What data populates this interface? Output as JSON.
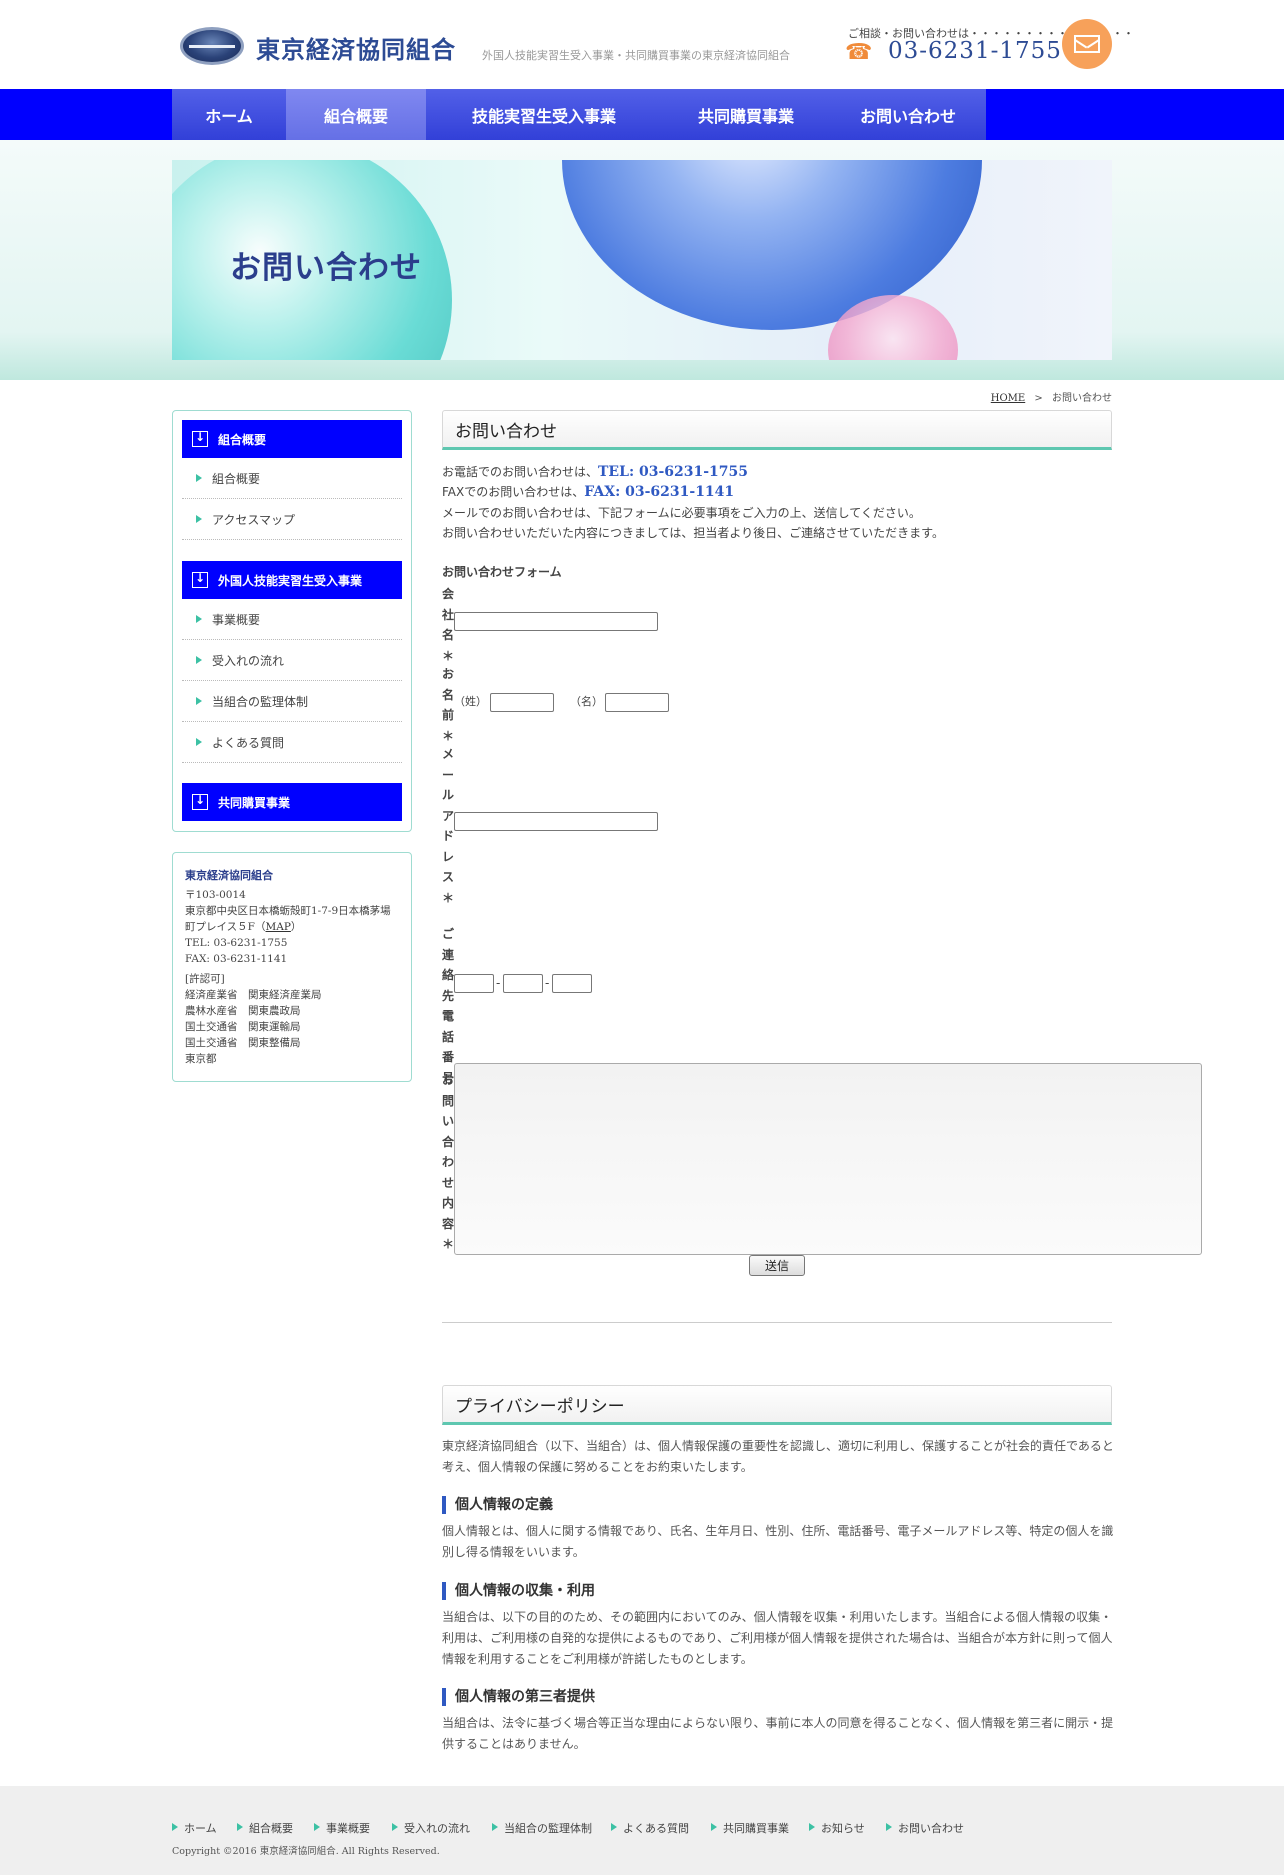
{
  "header": {
    "logo_text": "東京経済協同組合",
    "tagline": "外国人技能実習生受入事業・共同購買事業の東京経済協同組合",
    "contact_lead": "ご相談・お問い合わせは・・・・・・・・・・・・・・・",
    "phone": "03-6231-1755",
    "phone_icon": "☎"
  },
  "nav": {
    "items": [
      "ホーム",
      "組合概要",
      "技能実習生受入事業",
      "共同購買事業",
      "お問い合わせ"
    ]
  },
  "banner": {
    "title": "お問い合わせ"
  },
  "breadcrumb": {
    "home": "HOME",
    "sep": ">",
    "current": "お問い合わせ"
  },
  "sidebar": {
    "groups": [
      {
        "heading": "組合概要",
        "items": [
          "組合概要",
          "アクセスマップ"
        ]
      },
      {
        "heading": "外国人技能実習生受入事業",
        "items": [
          "事業概要",
          "受入れの流れ",
          "当組合の監理体制",
          "よくある質問"
        ]
      },
      {
        "heading": "共同購買事業",
        "items": []
      }
    ],
    "info": {
      "name": "東京経済協同組合",
      "postal": "〒103-0014",
      "address1": "東京都中央区日本橋蛎殻町1-7-9日本橋茅場",
      "address2_prefix": "町プレイス５F（",
      "map_link": "MAP",
      "address2_suffix": "）",
      "tel": "TEL: 03-6231-1755",
      "fax": "FAX: 03-6231-1141",
      "license_head": "[許認可]",
      "licenses": [
        "経済産業省　関東経済産業局",
        "農林水産省　関東農政局",
        "国土交通省　関東運輸局",
        "国土交通省　関東整備局",
        "東京都"
      ]
    }
  },
  "contact": {
    "section_title": "お問い合わせ",
    "line1_prefix": "お電話でのお問い合わせは、",
    "tel": "TEL: 03-6231-1755",
    "line2_prefix": "FAXでのお問い合わせは、",
    "fax": "FAX: 03-6231-1141",
    "line3": "メールでのお問い合わせは、下記フォームに必要事項をご入力の上、送信してください。",
    "line4": "お問い合わせいただいた内容につきましては、担当者より後日、ご連絡させていただきます。",
    "form_title": "お問い合わせフォーム",
    "labels": {
      "company": "会社名＊",
      "name": "お名前＊",
      "email": "メールアドレス＊",
      "phone": "ご連絡先電話番号",
      "inquiry": "お問い合わせ内容＊"
    },
    "last_name_label": "（姓）",
    "first_name_label": "（名）",
    "phone_sep": "-",
    "submit": "送信"
  },
  "privacy": {
    "title": "プライバシーポリシー",
    "intro": "東京経済協同組合（以下、当組合）は、個人情報保護の重要性を認識し、適切に利用し、保護することが社会的責任であると考え、個人情報の保護に努めることをお約束いたします。",
    "sections": [
      {
        "heading": "個人情報の定義",
        "body": "個人情報とは、個人に関する情報であり、氏名、生年月日、性別、住所、電話番号、電子メールアドレス等、特定の個人を識別し得る情報をいいます。"
      },
      {
        "heading": "個人情報の収集・利用",
        "body": "当組合は、以下の目的のため、その範囲内においてのみ、個人情報を収集・利用いたします。当組合による個人情報の収集・利用は、ご利用様の自発的な提供によるものであり、ご利用様が個人情報を提供された場合は、当組合が本方針に則って個人情報を利用することをご利用様が許諾したものとします。"
      },
      {
        "heading": "個人情報の第三者提供",
        "body": "当組合は、法令に基づく場合等正当な理由によらない限り、事前に本人の同意を得ることなく、個人情報を第三者に開示・提供することはありません。"
      }
    ]
  },
  "footer": {
    "links": [
      "ホーム",
      "組合概要",
      "事業概要",
      "受入れの流れ",
      "当組合の監理体制",
      "よくある質問",
      "共同購買事業",
      "お知らせ",
      "お問い合わせ"
    ],
    "copyright": "Copyright ©2016 東京経済協同組合. All Rights Reserved."
  },
  "colors": {
    "nav": "#0000ff",
    "accent": "#5ec7b0",
    "phone": "#2d4b94",
    "mail": "#f7a15a"
  }
}
